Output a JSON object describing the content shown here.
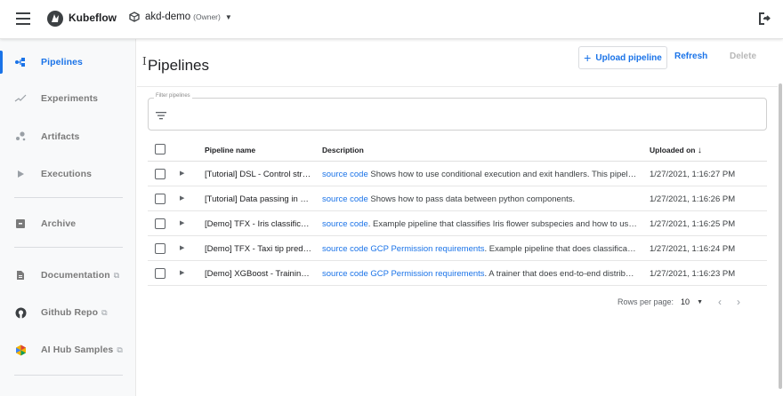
{
  "app": {
    "title": "Kubeflow"
  },
  "namespace": {
    "name": "akd-demo",
    "role": "(Owner)"
  },
  "sidebar": {
    "items": [
      {
        "label": "Pipelines",
        "icon": "pipelines-icon",
        "active": true
      },
      {
        "label": "Experiments",
        "icon": "experiments-icon"
      },
      {
        "label": "Artifacts",
        "icon": "artifacts-icon"
      },
      {
        "label": "Executions",
        "icon": "executions-icon"
      },
      {
        "label": "Archive",
        "icon": "archive-icon"
      },
      {
        "label": "Documentation",
        "icon": "document-icon",
        "external": true
      },
      {
        "label": "Github Repo",
        "icon": "github-icon",
        "external": true
      },
      {
        "label": "AI Hub Samples",
        "icon": "ai-hub-icon",
        "external": true
      }
    ]
  },
  "page": {
    "title": "Pipelines",
    "actions": {
      "upload": "Upload pipeline",
      "refresh": "Refresh",
      "delete": "Delete"
    },
    "filter": {
      "label": "Filter pipelines"
    }
  },
  "table": {
    "headers": {
      "name": "Pipeline name",
      "description": "Description",
      "uploaded": "Uploaded on"
    },
    "rows": [
      {
        "name": "[Tutorial] DSL - Control structures",
        "links": [
          "source code"
        ],
        "desc": " Shows how to use conditional execution and exit handlers. This pipeline will randomly fail",
        "date": "1/27/2021, 1:16:27 PM"
      },
      {
        "name": "[Tutorial] Data passing in python components",
        "links": [
          "source code"
        ],
        "desc": " Shows how to pass data between python components.",
        "date": "1/27/2021, 1:16:26 PM"
      },
      {
        "name": "[Demo] TFX - Iris classification",
        "links": [
          "source code"
        ],
        "desc": ". Example pipeline that classifies Iris flower subspecies and how to use native Keras",
        "date": "1/27/2021, 1:16:25 PM"
      },
      {
        "name": "[Demo] TFX - Taxi tip prediction",
        "links": [
          "source code",
          "GCP Permission requirements"
        ],
        "desc": ". Example pipeline that does classification with model analysis",
        "date": "1/27/2021, 1:16:24 PM"
      },
      {
        "name": "[Demo] XGBoost - Training with confusion matrix",
        "links": [
          "source code",
          "GCP Permission requirements"
        ],
        "desc": ". A trainer that does end-to-end distributed training for XGBoost",
        "date": "1/27/2021, 1:16:23 PM"
      }
    ]
  },
  "pagination": {
    "label": "Rows per page:",
    "value": "10"
  }
}
